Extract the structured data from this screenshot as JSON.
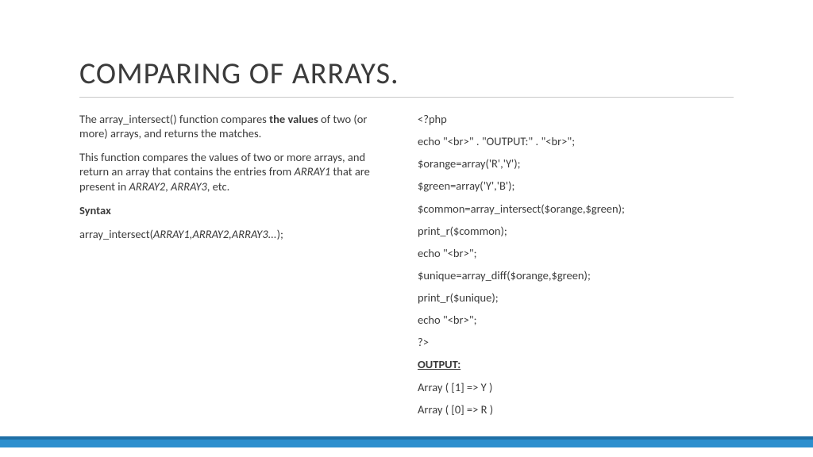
{
  "title": "COMPARING OF ARRAYS.",
  "left": {
    "p1_a": "The array_intersect() function compares ",
    "p1_b": "the values",
    "p1_c": " of two (or more) arrays, and returns the matches.",
    "p2_a": "This function compares the values of two or more arrays, and return an array that contains the entries from ",
    "p2_b": "ARRAY1",
    "p2_c": " that are present in ",
    "p2_d": "ARRAY2",
    "p2_e": ", ",
    "p2_f": "ARRAY3",
    "p2_g": ", etc.",
    "syntax_label": "Syntax",
    "syntax_a": "array_intersect(",
    "syntax_b": "ARRAY1,ARRAY2,ARRAY3...",
    "syntax_c": ");"
  },
  "right": {
    "l1": "<?php",
    "l2": "echo \"<br>\" . \"OUTPUT:\" . \"<br>\";",
    "l3": "$orange=array('R','Y');",
    "l4": "$green=array('Y','B');",
    "l5": "$common=array_intersect($orange,$green);",
    "l6": "print_r($common);",
    "l7": "echo \"<br>\";",
    "l8": "$unique=array_diff($orange,$green);",
    "l9": "print_r($unique);",
    "l10": "echo \"<br>\";",
    "l11": "?>",
    "output_label": "OUTPUT:",
    "out1": "Array ( [1] => Y )",
    "out2": "Array ( [0] => R )"
  }
}
